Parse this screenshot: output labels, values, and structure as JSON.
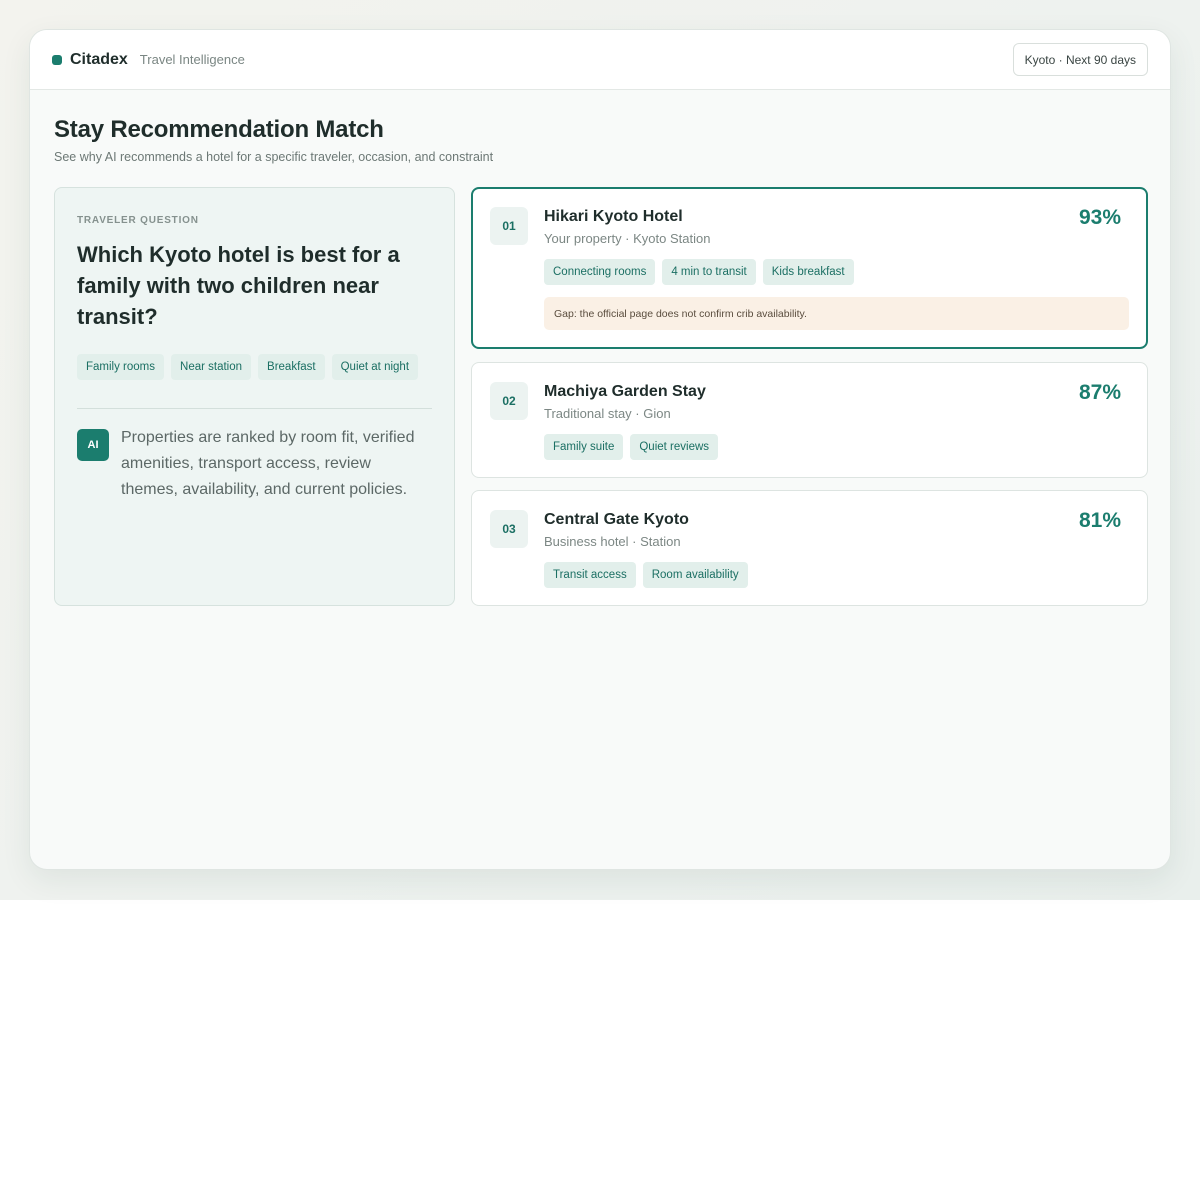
{
  "brand": {
    "name": "Citadex",
    "tagline": "Travel Intelligence"
  },
  "scope": "Kyoto · Next 90 days",
  "page": {
    "title": "Stay Recommendation Match",
    "subtitle": "See why AI recommends a hotel for a specific traveler, occasion, and constraint"
  },
  "question": {
    "label": "TRAVELER QUESTION",
    "text": "Which Kyoto hotel is best for a family with two children near transit?",
    "tags": [
      "Family rooms",
      "Near station",
      "Breakfast",
      "Quiet at night"
    ],
    "ai_badge": "AI",
    "ai_note": "Properties are ranked by room fit, verified amenities, transport access, review themes, availability, and current policies."
  },
  "results": [
    {
      "rank": "01",
      "name": "Hikari Kyoto Hotel",
      "meta": "Your property · Kyoto Station",
      "score": "93%",
      "tags": [
        "Connecting rooms",
        "4 min to transit",
        "Kids breakfast"
      ],
      "gap": "Gap: the official page does not confirm crib availability."
    },
    {
      "rank": "02",
      "name": "Machiya Garden Stay",
      "meta": "Traditional stay · Gion",
      "score": "87%",
      "tags": [
        "Family suite",
        "Quiet reviews"
      ]
    },
    {
      "rank": "03",
      "name": "Central Gate Kyoto",
      "meta": "Business hotel · Station",
      "score": "81%",
      "tags": [
        "Transit access",
        "Room availability"
      ]
    }
  ],
  "colors": {
    "accent": "#1b7d6e",
    "gap_background": "#faf0e5"
  }
}
